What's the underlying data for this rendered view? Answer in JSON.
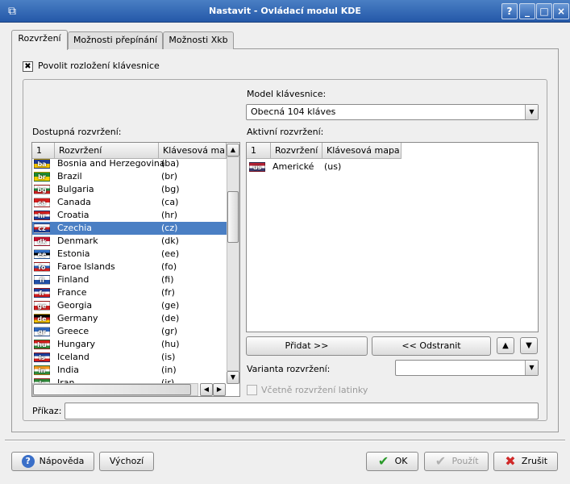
{
  "window": {
    "title": "Nastavit - Ovládací modul KDE",
    "help_btn": "?",
    "minimize_btn": "_",
    "maximize_btn": "□",
    "close_btn": "×"
  },
  "tabs": [
    {
      "label": "Rozvržení",
      "active": true
    },
    {
      "label": "Možnosti přepínání",
      "active": false
    },
    {
      "label": "Možnosti Xkb",
      "active": false
    }
  ],
  "enable_layouts": {
    "label": "Povolit rozložení klávesnice",
    "checked": true,
    "mark": "✖"
  },
  "keyboard_model": {
    "label": "Model klávesnice:",
    "value": "Obecná 104 kláves"
  },
  "available": {
    "label": "Dostupná rozvržení:",
    "headers": [
      "1",
      "Rozvržení",
      "Klávesová mapa"
    ],
    "rows": [
      {
        "flag": "ba",
        "name": "Bosnia and Herzegovina",
        "map": "(ba)",
        "colors": [
          "#1f3b9a",
          "#f4c400"
        ]
      },
      {
        "flag": "br",
        "name": "Brazil",
        "map": "(br)",
        "colors": [
          "#1f8a2e",
          "#f4d000"
        ]
      },
      {
        "flag": "bg",
        "name": "Bulgaria",
        "map": "(bg)",
        "colors": [
          "#ffffff",
          "#1e8a3c",
          "#cc1f1f"
        ]
      },
      {
        "flag": "ca",
        "name": "Canada",
        "map": "(ca)",
        "colors": [
          "#d81e1e",
          "#ffffff"
        ]
      },
      {
        "flag": "hr",
        "name": "Croatia",
        "map": "(hr)",
        "colors": [
          "#d41e1e",
          "#ffffff",
          "#1b3d9a"
        ]
      },
      {
        "flag": "cz",
        "name": "Czechia",
        "map": "(cz)",
        "colors": [
          "#ffffff",
          "#d41e1e",
          "#1b3d9a"
        ],
        "selected": true
      },
      {
        "flag": "dk",
        "name": "Denmark",
        "map": "(dk)",
        "colors": [
          "#c8102e",
          "#ffffff"
        ]
      },
      {
        "flag": "ee",
        "name": "Estonia",
        "map": "(ee)",
        "colors": [
          "#2f6fc9",
          "#000000",
          "#ffffff"
        ]
      },
      {
        "flag": "fo",
        "name": "Faroe Islands",
        "map": "(fo)",
        "colors": [
          "#ffffff",
          "#2860b8",
          "#d41e1e"
        ]
      },
      {
        "flag": "fi",
        "name": "Finland",
        "map": "(fi)",
        "colors": [
          "#ffffff",
          "#1f4fa8"
        ]
      },
      {
        "flag": "fr",
        "name": "France",
        "map": "(fr)",
        "colors": [
          "#1f3b9a",
          "#ffffff",
          "#d41e1e"
        ]
      },
      {
        "flag": "ge",
        "name": "Georgia",
        "map": "(ge)",
        "colors": [
          "#ffffff",
          "#d41e1e"
        ]
      },
      {
        "flag": "de",
        "name": "Germany",
        "map": "(de)",
        "colors": [
          "#000000",
          "#d41e1e",
          "#f4c400"
        ]
      },
      {
        "flag": "gr",
        "name": "Greece",
        "map": "(gr)",
        "colors": [
          "#2e68c0",
          "#ffffff"
        ]
      },
      {
        "flag": "hu",
        "name": "Hungary",
        "map": "(hu)",
        "colors": [
          "#d41e1e",
          "#ffffff",
          "#2e8a3a"
        ]
      },
      {
        "flag": "is",
        "name": "Iceland",
        "map": "(is)",
        "colors": [
          "#1b3d9a",
          "#ffffff",
          "#d41e1e"
        ]
      },
      {
        "flag": "in",
        "name": "India",
        "map": "(in)",
        "colors": [
          "#f59a20",
          "#ffffff",
          "#2e8a3a"
        ]
      },
      {
        "flag": "ir",
        "name": "Iran",
        "map": "(ir)",
        "colors": [
          "#2e8a3a",
          "#ffffff",
          "#d41e1e"
        ]
      }
    ]
  },
  "active": {
    "label": "Aktivní rozvržení:",
    "headers": [
      "1",
      "Rozvržení",
      "Klávesová mapa"
    ],
    "rows": [
      {
        "flag": "us",
        "name": "Americké",
        "map": "(us)",
        "colors": [
          "#b22234",
          "#ffffff",
          "#3c3b6e"
        ]
      }
    ]
  },
  "buttons": {
    "add": "Přidat >>",
    "remove": "<< Odstranit",
    "move_up": "▲",
    "move_down": "▼",
    "help": "Nápověda",
    "defaults": "Výchozí",
    "ok": "OK",
    "apply": "Použít",
    "cancel": "Zrušit"
  },
  "variant": {
    "label": "Varianta rozvržení:",
    "value": ""
  },
  "include_latin": {
    "label": "Včetně rozvržení latinky",
    "checked": false
  },
  "command": {
    "label": "Příkaz:",
    "value": ""
  },
  "icons": {
    "scroll_up": "▲",
    "scroll_down": "▼",
    "scroll_left": "◀",
    "scroll_right": "▶",
    "combo_arrow": "▼",
    "help_icon": "?",
    "ok_icon": "✔",
    "apply_icon": "✔",
    "cancel_icon": "✖"
  },
  "colors": {
    "selection": "#4a7fc4",
    "titlebar": "#2458a8",
    "ok_green": "#2a9a2a",
    "cancel_red": "#d02828",
    "help_blue": "#3a6fc8"
  }
}
